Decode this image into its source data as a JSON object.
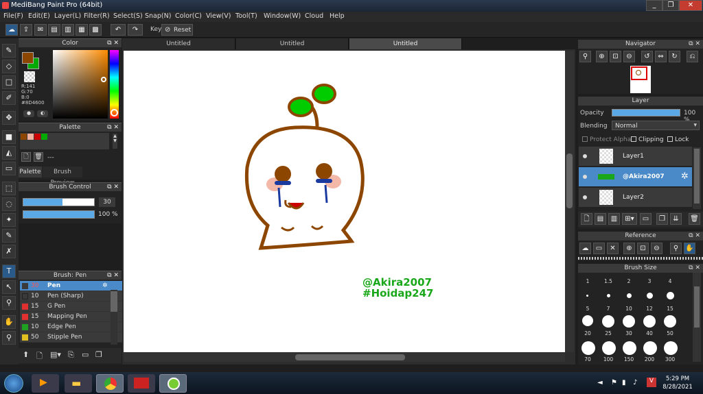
{
  "window": {
    "title": "MediBang Paint Pro (64bit)",
    "min": "_",
    "max": "❐",
    "close": "✕"
  },
  "menu": [
    "File(F)",
    "Edit(E)",
    "Layer(L)",
    "Filter(R)",
    "Select(S)",
    "Snap(N)",
    "Color(C)",
    "View(V)",
    "Tool(T)",
    "Window(W)",
    "Cloud",
    "Help"
  ],
  "toolbar": {
    "key_label": "Key",
    "reset_label": "Reset"
  },
  "tabs": [
    "Untitled",
    "Untitled",
    "Untitled"
  ],
  "color_panel": {
    "title": "Color",
    "r": "R:141",
    "g": "G:70",
    "b": "B:0",
    "hex": "#8D4600",
    "primary": "#8d4600",
    "secondary": "#00aa00"
  },
  "palette_panel": {
    "title": "Palette",
    "swatches": [
      "#8d4600",
      "#f0b0a0",
      "#cc0000",
      "#00aa00"
    ],
    "dash": "---",
    "tab1": "Palette",
    "tab2": "Brush Preview"
  },
  "brush_control": {
    "title": "Brush Control",
    "size": "30",
    "opacity": "100 %"
  },
  "brush_panel": {
    "title": "Brush: Pen",
    "items": [
      {
        "size": "30",
        "name": "Pen",
        "color": "#3a3a3a"
      },
      {
        "size": "10",
        "name": "Pen (Sharp)",
        "color": "#3a3a3a"
      },
      {
        "size": "15",
        "name": "G Pen",
        "color": "#e03030"
      },
      {
        "size": "15",
        "name": "Mapping Pen",
        "color": "#e03030"
      },
      {
        "size": "10",
        "name": "Edge Pen",
        "color": "#20a020"
      },
      {
        "size": "50",
        "name": "Stipple Pen",
        "color": "#e0c020"
      }
    ]
  },
  "canvas": {
    "watermark1": "@Akira2007",
    "watermark2": "#Hoidap247",
    "colors": {
      "outline": "#8d4600",
      "leaf": "#00cc00",
      "blush": "#f4b8a8",
      "tear": "#1a3aa0",
      "mouth": "#cc0000"
    }
  },
  "navigator": {
    "title": "Navigator"
  },
  "layer_panel": {
    "title": "Layer",
    "opacity_label": "Opacity",
    "opacity_value": "100 %",
    "blending_label": "Blending",
    "blending_value": "Normal",
    "protect_alpha": "Protect Alpha",
    "clipping": "Clipping",
    "lock": "Lock",
    "layers": [
      {
        "name": "Layer1",
        "selected": false
      },
      {
        "name": "@Akira2007",
        "selected": true
      },
      {
        "name": "Layer2",
        "selected": false
      }
    ]
  },
  "reference": {
    "title": "Reference"
  },
  "brush_size": {
    "title": "Brush Size",
    "labels_row1": [
      "1",
      "1.5",
      "2",
      "3",
      "4"
    ],
    "labels_row2": [
      "5",
      "7",
      "10",
      "12",
      "15"
    ],
    "labels_row3": [
      "20",
      "25",
      "30",
      "40",
      "50"
    ],
    "labels_row4": [
      "70",
      "100",
      "150",
      "200",
      "300"
    ]
  },
  "taskbar": {
    "time": "5:29 PM",
    "date": "8/28/2021"
  }
}
